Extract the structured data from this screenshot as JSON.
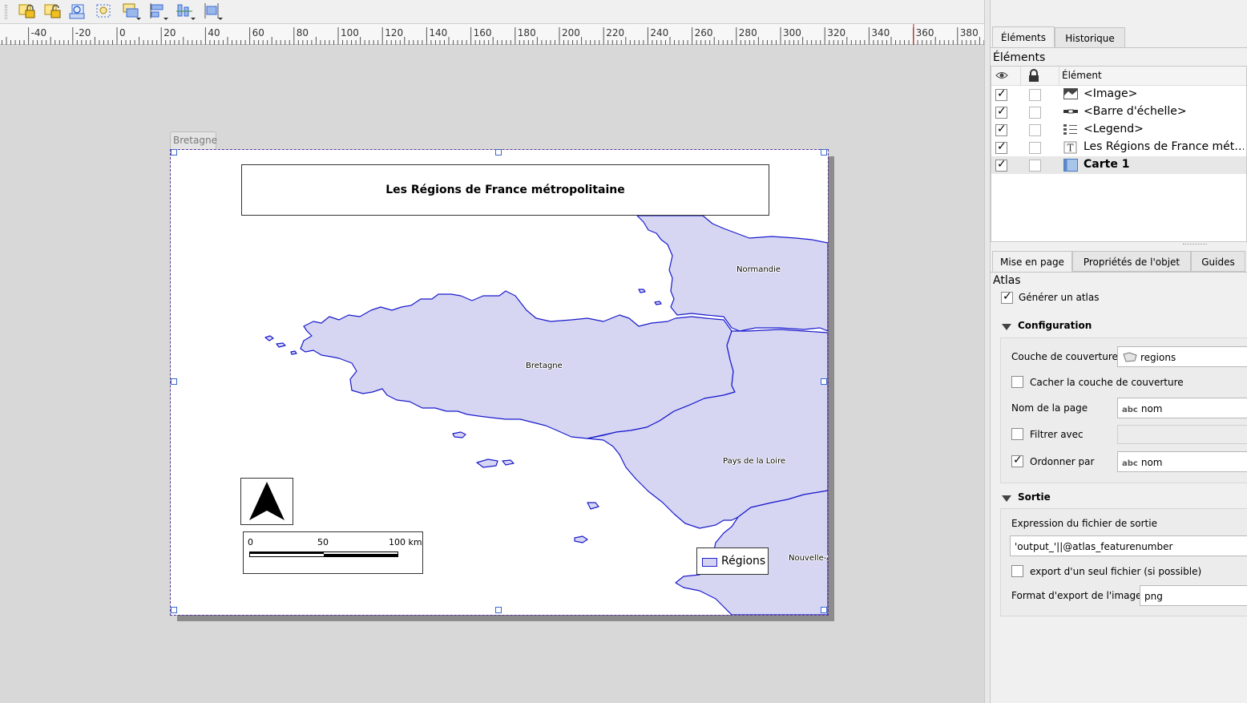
{
  "toolbar": {
    "buttons": [
      "lock-items-icon",
      "unlock-items-icon",
      "group-icon",
      "ungroup-icon",
      "raise-icon",
      "align-icon",
      "distribute-icon",
      "resize-icon"
    ]
  },
  "ruler": {
    "ticks": [
      "-40",
      "-20",
      "0",
      "20",
      "40",
      "60",
      "80",
      "100",
      "120",
      "140",
      "160",
      "180",
      "200",
      "220",
      "240",
      "260",
      "280",
      "300",
      "320",
      "340",
      "360",
      "380"
    ]
  },
  "layout": {
    "page_tab": "Bretagne",
    "title": "Les Régions de France métropolitaine",
    "region_labels": {
      "normandie": "Normandie",
      "bretagne": "Bretagne",
      "pays_de_la_loire": "Pays de la Loire",
      "nouvelle_aquitaine": "Nouvelle-A"
    },
    "scale_bar": {
      "labels": [
        "0",
        "50",
        "100 km"
      ]
    },
    "legend": {
      "label": "Régions",
      "fill": "#d4d4f2",
      "stroke": "#2020d0"
    },
    "map_colors": {
      "fill": "#d6d6f3",
      "stroke": "#1a1acc"
    }
  },
  "panel": {
    "tabs_top": [
      "Éléments",
      "Historique"
    ],
    "elements_heading": "Éléments",
    "elements_column": "Élément",
    "elements": [
      {
        "label": "<Image>",
        "visible": true,
        "locked": false,
        "icon": "image-icon"
      },
      {
        "label": "<Barre d'échelle>",
        "visible": true,
        "locked": false,
        "icon": "scalebar-icon"
      },
      {
        "label": "<Legend>",
        "visible": true,
        "locked": false,
        "icon": "legend-icon"
      },
      {
        "label": "Les Régions de France mét…",
        "visible": true,
        "locked": false,
        "icon": "text-icon"
      },
      {
        "label": "Carte 1",
        "visible": true,
        "locked": false,
        "icon": "map-icon"
      }
    ],
    "tabs_bottom": [
      "Mise en page",
      "Propriétés de l'objet",
      "Guides"
    ],
    "atlas": {
      "heading": "Atlas",
      "generate_label": "Générer un atlas",
      "generate_checked": true,
      "configuration": {
        "title": "Configuration",
        "coverage_label": "Couche de couverture",
        "coverage_value": "regions",
        "hide_coverage_label": "Cacher la couche de couverture",
        "hide_coverage_checked": false,
        "page_name_label": "Nom de la page",
        "page_name_value": "nom",
        "filter_label": "Filtrer avec",
        "filter_checked": false,
        "sort_label": "Ordonner par",
        "sort_checked": true,
        "sort_value": "nom",
        "abc": "abc"
      },
      "output": {
        "title": "Sortie",
        "expression_label": "Expression du fichier de sortie",
        "expression_value": "'output_'||@atlas_featurenumber",
        "single_file_label": "export d'un seul fichier (si possible)",
        "single_file_checked": false,
        "format_label": "Format d'export de l'image",
        "format_value": "png"
      }
    }
  }
}
